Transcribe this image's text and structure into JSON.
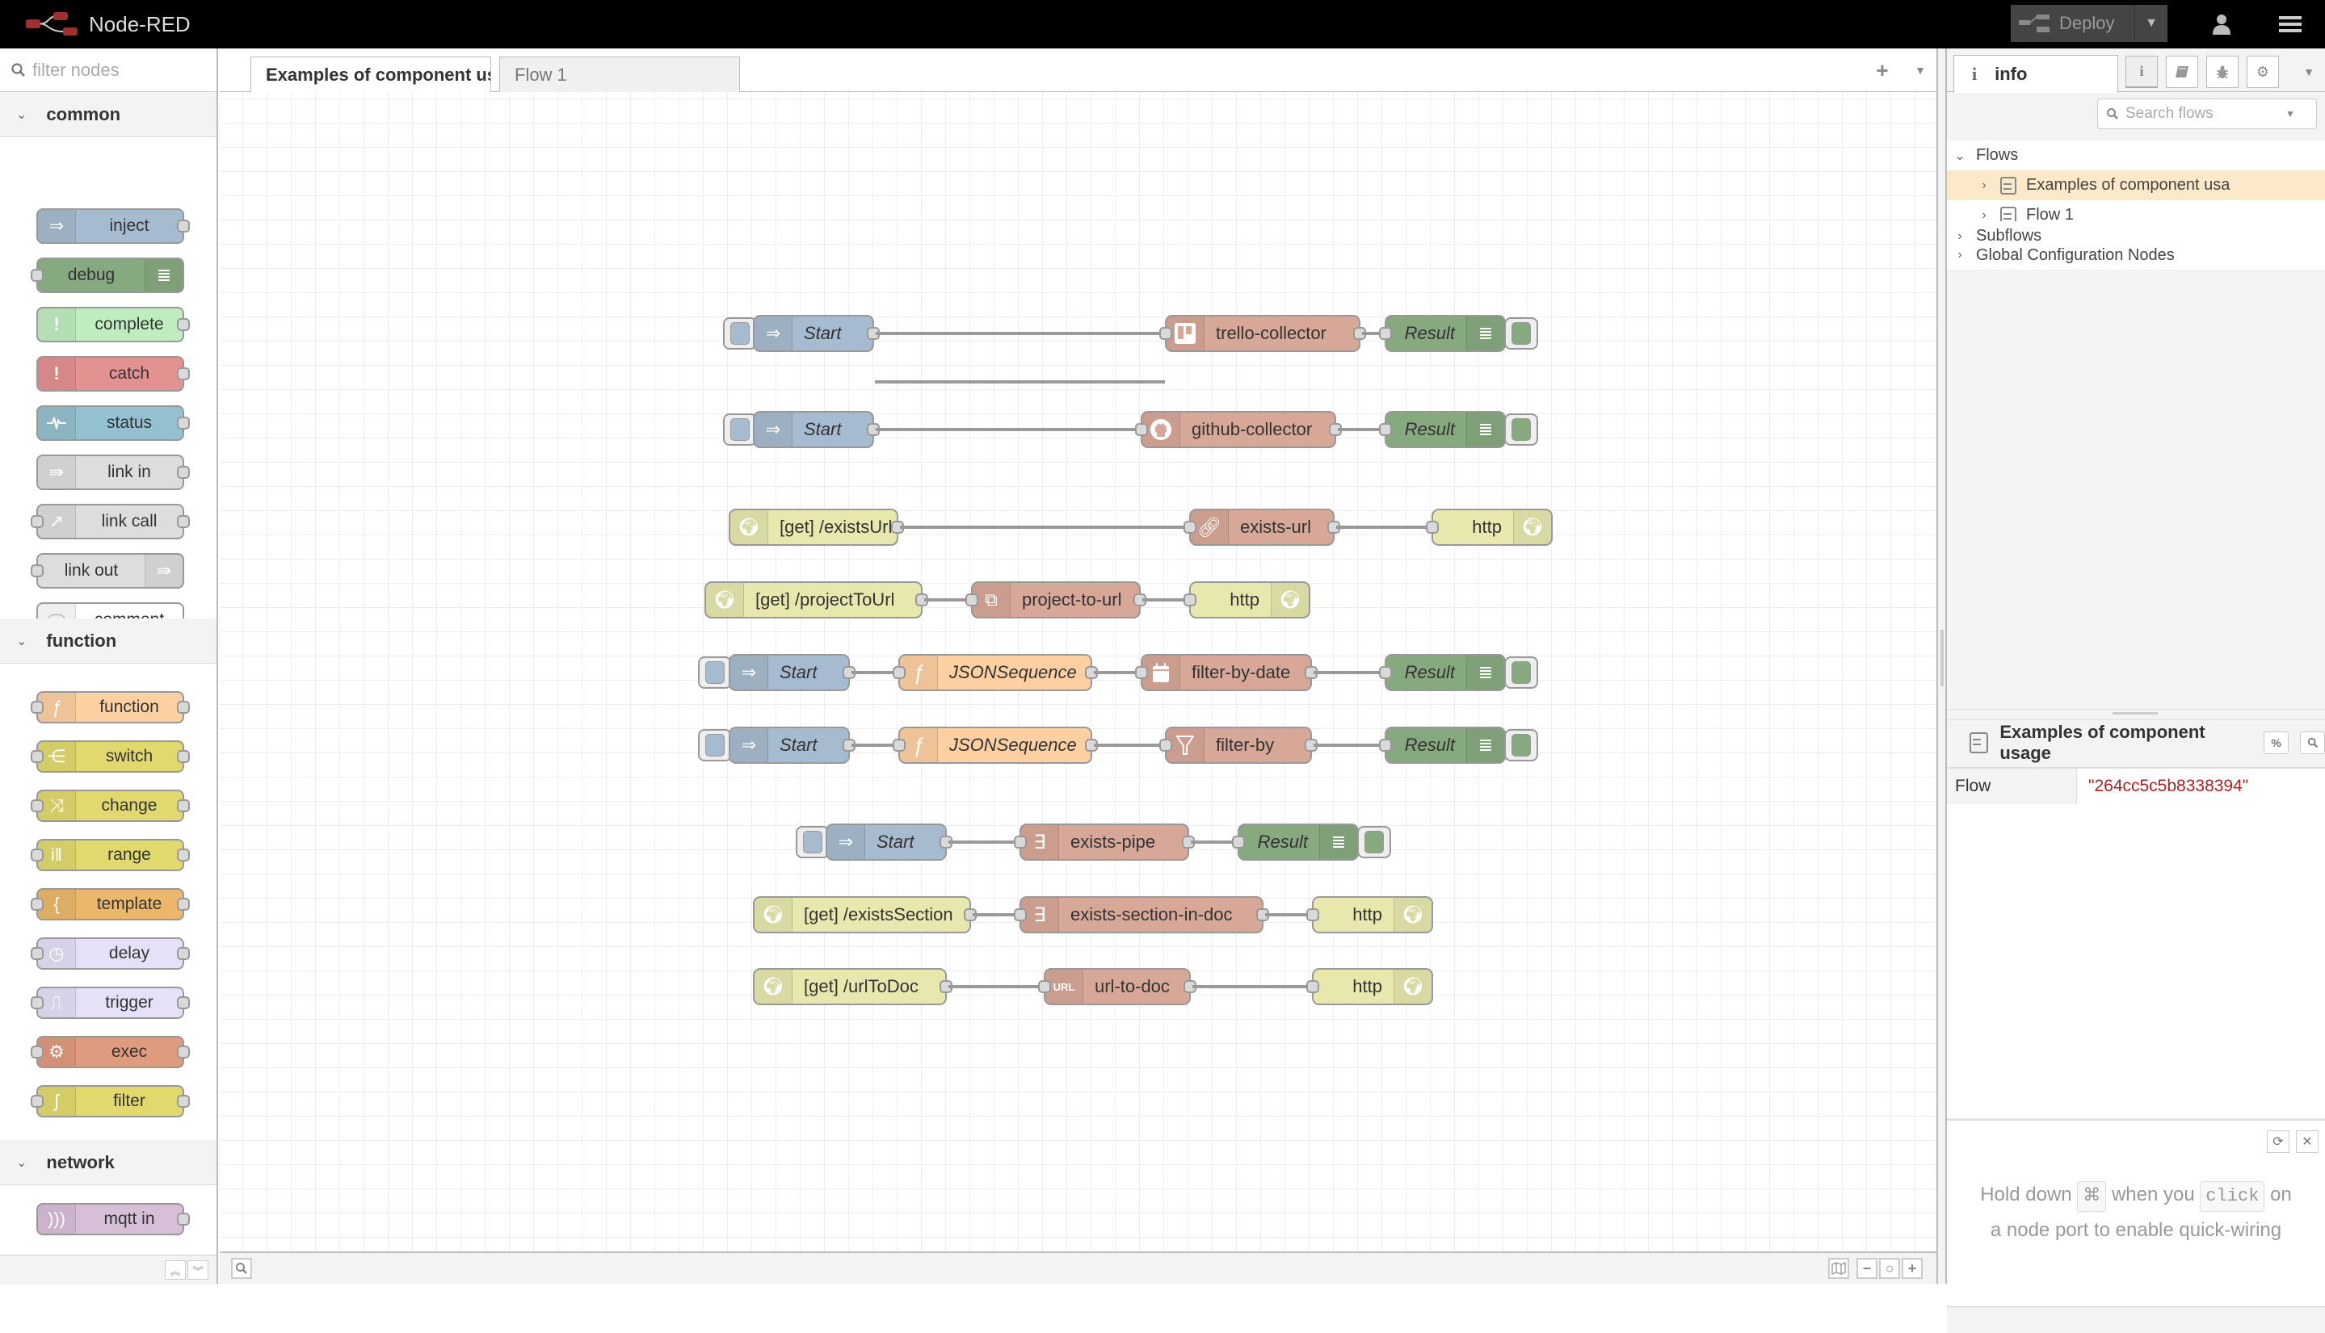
{
  "header": {
    "app_title": "Node-RED",
    "deploy_label": "Deploy"
  },
  "palette": {
    "search_placeholder": "filter nodes",
    "categories": [
      {
        "label": "common",
        "nodes": [
          {
            "label": "inject",
            "icon": "inject-arrow-icon",
            "color": "#a6bbcf"
          },
          {
            "label": "debug",
            "icon": "debug-list-icon",
            "color": "#87a980"
          },
          {
            "label": "complete",
            "icon": "exclamation-icon",
            "color": "#c0edc0"
          },
          {
            "label": "catch",
            "icon": "exclamation-icon",
            "color": "#e49191"
          },
          {
            "label": "status",
            "icon": "pulse-icon",
            "color": "#94c1d0"
          },
          {
            "label": "link in",
            "icon": "link-in-icon",
            "color": "#dddddd"
          },
          {
            "label": "link call",
            "icon": "link-call-icon",
            "color": "#dddddd"
          },
          {
            "label": "link out",
            "icon": "link-out-icon",
            "color": "#dddddd"
          },
          {
            "label": "comment",
            "icon": "speech-bubble-icon",
            "color": "#ffffff"
          }
        ]
      },
      {
        "label": "function",
        "nodes": [
          {
            "label": "function",
            "icon": "function-f-icon",
            "color": "#fdd0a2"
          },
          {
            "label": "switch",
            "icon": "switch-icon",
            "color": "#e2d96e"
          },
          {
            "label": "change",
            "icon": "shuffle-icon",
            "color": "#e2d96e"
          },
          {
            "label": "range",
            "icon": "range-icon",
            "color": "#e2d96e"
          },
          {
            "label": "template",
            "icon": "brace-icon",
            "color": "#ebb86b"
          },
          {
            "label": "delay",
            "icon": "timer-icon",
            "color": "#e6e0f8"
          },
          {
            "label": "trigger",
            "icon": "trigger-pulse-icon",
            "color": "#e6e0f8"
          },
          {
            "label": "exec",
            "icon": "gear-icon",
            "color": "#e09a7d"
          },
          {
            "label": "filter",
            "icon": "filter-rbe-icon",
            "color": "#e2d96e"
          }
        ]
      },
      {
        "label": "network",
        "nodes": [
          {
            "label": "mqtt in",
            "icon": "wifi-waves-icon",
            "color": "#d8bfd8"
          }
        ]
      }
    ]
  },
  "workspace": {
    "tabs": [
      {
        "label": "Examples of component usa",
        "active": true
      },
      {
        "label": "Flow 1",
        "active": false
      }
    ]
  },
  "flow": {
    "rows": [
      [
        "Start",
        "trello-collector",
        "Result"
      ],
      [
        "Start",
        "github-collector",
        "Result"
      ],
      [
        "[get] /existsUrl",
        "exists-url",
        "http"
      ],
      [
        "[get] /projectToUrl",
        "project-to-url",
        "http"
      ],
      [
        "Start",
        "JSONSequence",
        "filter-by-date",
        "Result"
      ],
      [
        "Start",
        "JSONSequence",
        "filter-by",
        "Result"
      ],
      [
        "Start",
        "exists-pipe",
        "Result"
      ],
      [
        "[get] /existsSection",
        "exists-section-in-doc",
        "http"
      ],
      [
        "[get] /urlToDoc",
        "url-to-doc",
        "http"
      ]
    ],
    "colors": {
      "inject": "#a6bbcf",
      "debug": "#87a980",
      "custom": "#d7a797",
      "http": "#e7e7ae",
      "function": "#fdd0a2"
    }
  },
  "sidebar": {
    "tab_label": "info",
    "search_placeholder": "Search flows",
    "tree": {
      "flows_label": "Flows",
      "flows": [
        "Examples of component usa",
        "Flow 1"
      ],
      "subflows_label": "Subflows",
      "global_config_label": "Global Configuration Nodes"
    },
    "info": {
      "title": "Examples of component usage",
      "key": "Flow",
      "value": "\"264cc5c5b8338394\""
    },
    "tip": {
      "part1": "Hold down",
      "key": "⌘",
      "part2": "when you",
      "action": "click",
      "part3": "on",
      "line2": "a node port to enable quick-wiring"
    }
  }
}
